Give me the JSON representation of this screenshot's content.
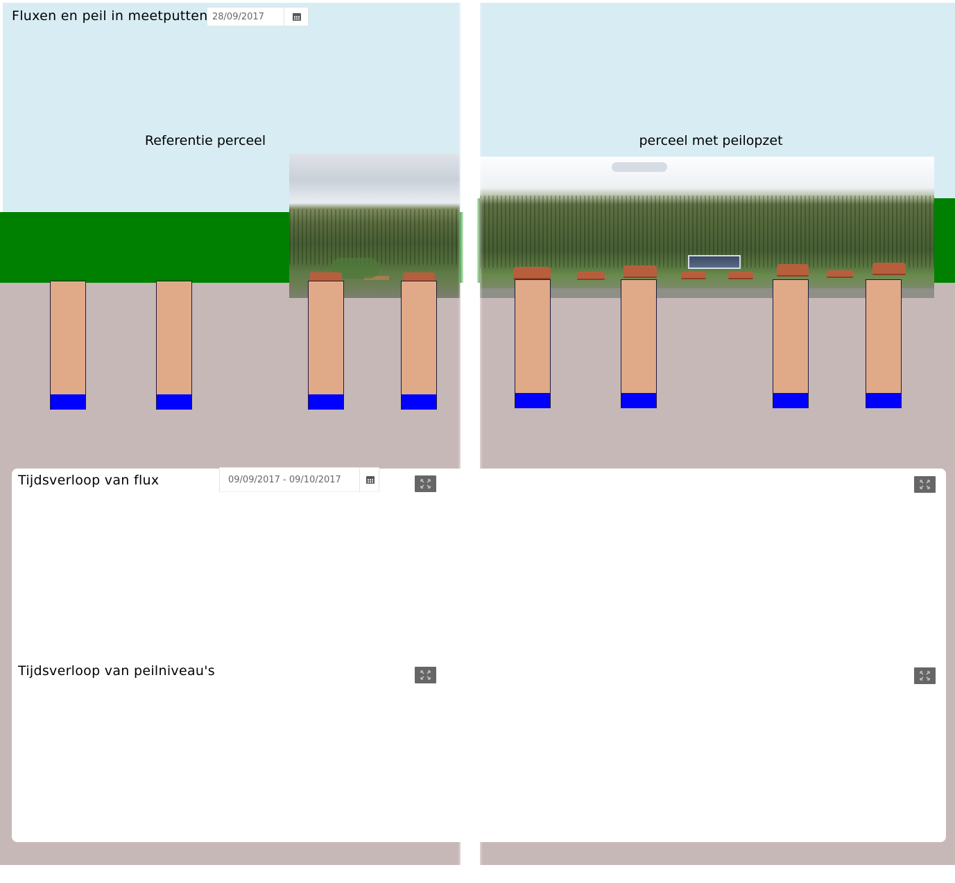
{
  "header": {
    "title": "Fluxen en peil in meetputten",
    "date_value": "28/09/2017",
    "calendar_icon": "calendar-icon"
  },
  "scene": {
    "left_label": "Referentie perceel",
    "right_label": "perceel met peilopzet",
    "colors": {
      "sky": "#d8ecf3",
      "grass": "#008000",
      "soil": "#c7b8b8",
      "well": "#e0aa88",
      "water": "#0000ff"
    }
  },
  "flux_panel": {
    "title": "Tijdsverloop van flux",
    "date_range": "09/09/2017 - 09/10/2017",
    "calendar_icon": "calendar-icon",
    "expand_icon": "expand-icon"
  },
  "level_panel": {
    "title": "Tijdsverloop van peilniveau's",
    "expand_icon": "expand-icon"
  }
}
